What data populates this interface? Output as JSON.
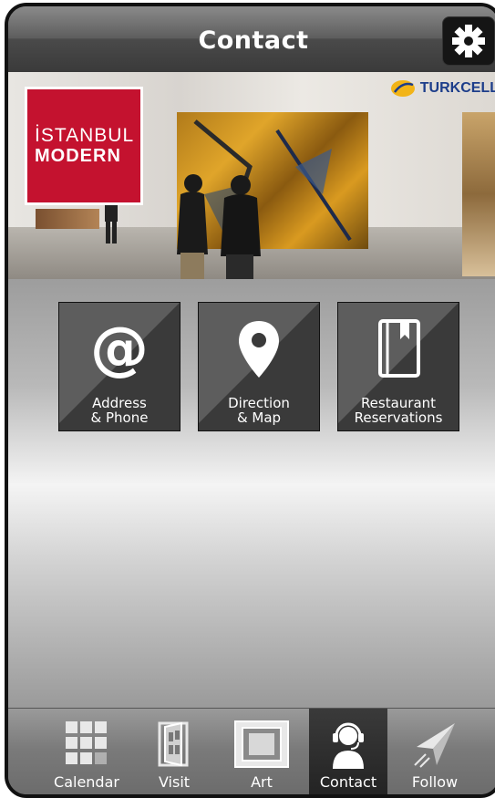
{
  "header": {
    "title": "Contact"
  },
  "banner": {
    "logo_line1": "İSTANBUL",
    "logo_line2": "MODERN",
    "sponsor": "TURKCELL"
  },
  "tiles": [
    {
      "line1": "Address",
      "line2": "& Phone",
      "icon": "at-icon"
    },
    {
      "line1": "Direction",
      "line2": "& Map",
      "icon": "map-pin-icon"
    },
    {
      "line1": "Restaurant",
      "line2": "Reservations",
      "icon": "book-icon"
    }
  ],
  "tabbar": {
    "items": [
      {
        "label": "Calendar",
        "icon": "grid-icon"
      },
      {
        "label": "Visit",
        "icon": "door-icon"
      },
      {
        "label": "Art",
        "icon": "frame-icon"
      },
      {
        "label": "Contact",
        "icon": "headset-icon",
        "active": true
      },
      {
        "label": "Follow",
        "icon": "paper-plane-icon"
      }
    ]
  },
  "colors": {
    "brand_red": "#c4122f",
    "tile_bg": "#3a3a3a",
    "turkcell_blue": "#1c3d8a"
  }
}
